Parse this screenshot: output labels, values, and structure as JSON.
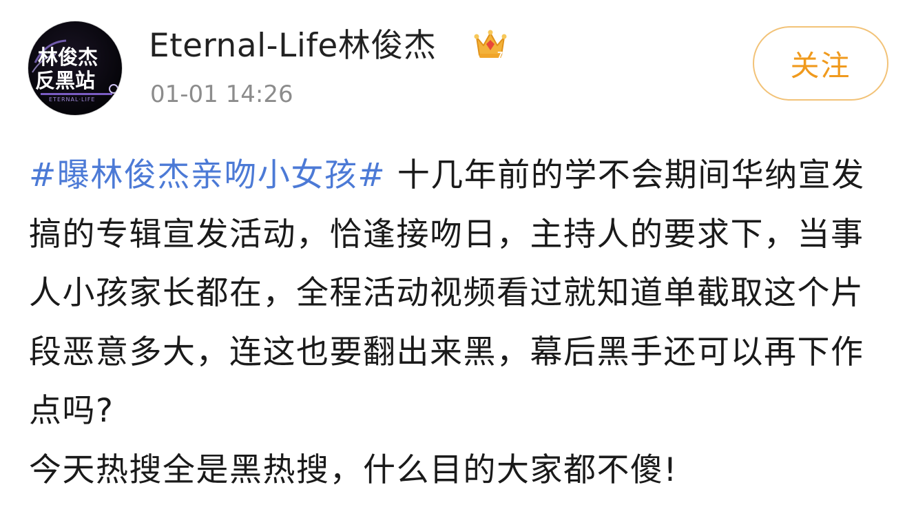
{
  "post": {
    "avatar": {
      "line1": "林俊杰",
      "line2": "反黑站",
      "sub": "ETERNAL·LIFE"
    },
    "username": "Eternal-Life林俊杰",
    "badge_icon": "crown-badge-icon",
    "timestamp": "01-01 14:26",
    "follow_label": "关注",
    "hashtag": "#曝林俊杰亲吻小女孩#",
    "body_text": " 十几年前的学不会期间华纳宣发搞的专辑宣发活动，恰逢接吻日，主持人的要求下，当事人小孩家长都在，全程活动视频看过就知道单截取这个片段恶意多大，连这也要翻出来黑，幕后黑手还可以再下作点吗?",
    "second_paragraph": "今天热搜全是黑热搜，什么目的大家都不傻!"
  },
  "colors": {
    "hashtag": "#4c7ad6",
    "follow": "#f09a1d",
    "follow_border": "#f2c277",
    "timestamp": "#8c8c8c"
  }
}
